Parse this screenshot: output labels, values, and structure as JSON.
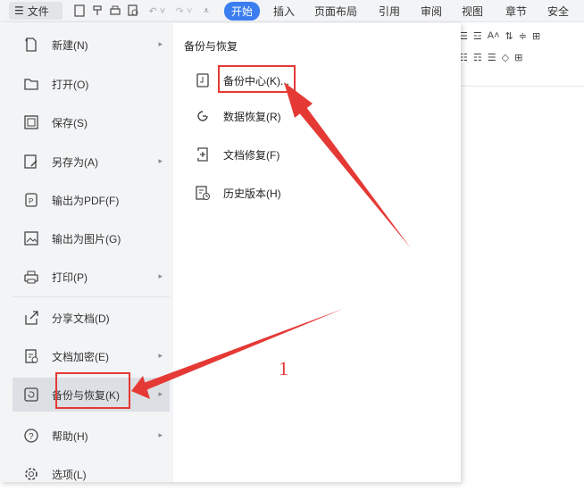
{
  "toolbar": {
    "file_label": "文件",
    "tabs": [
      {
        "label": "开始",
        "active": true
      },
      {
        "label": "插入"
      },
      {
        "label": "页面布局"
      },
      {
        "label": "引用"
      },
      {
        "label": "审阅"
      },
      {
        "label": "视图"
      },
      {
        "label": "章节"
      },
      {
        "label": "安全"
      }
    ]
  },
  "menu": {
    "items": [
      {
        "label": "新建(N)",
        "icon": "new-doc-icon",
        "has_submenu": true
      },
      {
        "label": "打开(O)",
        "icon": "folder-icon",
        "has_submenu": false
      },
      {
        "label": "保存(S)",
        "icon": "save-icon",
        "has_submenu": false
      },
      {
        "label": "另存为(A)",
        "icon": "save-as-icon",
        "has_submenu": true
      },
      {
        "label": "输出为PDF(F)",
        "icon": "pdf-icon",
        "has_submenu": false
      },
      {
        "label": "输出为图片(G)",
        "icon": "image-icon",
        "has_submenu": false
      },
      {
        "label": "打印(P)",
        "icon": "print-icon",
        "has_submenu": true
      },
      {
        "label": "分享文档(D)",
        "icon": "share-icon",
        "has_submenu": false
      },
      {
        "label": "文档加密(E)",
        "icon": "encrypt-icon",
        "has_submenu": true
      },
      {
        "label": "备份与恢复(K)",
        "icon": "backup-icon",
        "has_submenu": true,
        "selected": true
      },
      {
        "label": "帮助(H)",
        "icon": "help-icon",
        "has_submenu": true
      },
      {
        "label": "选项(L)",
        "icon": "options-icon",
        "has_submenu": false
      }
    ]
  },
  "submenu": {
    "title": "备份与恢复",
    "items": [
      {
        "label": "备份中心(K)...",
        "icon": "backup-center-icon"
      },
      {
        "label": "数据恢复(R)",
        "icon": "data-recovery-icon"
      },
      {
        "label": "文档修复(F)",
        "icon": "doc-repair-icon"
      },
      {
        "label": "历史版本(H)",
        "icon": "history-version-icon"
      }
    ]
  },
  "annotation": {
    "number": "1",
    "color": "#e53935"
  }
}
